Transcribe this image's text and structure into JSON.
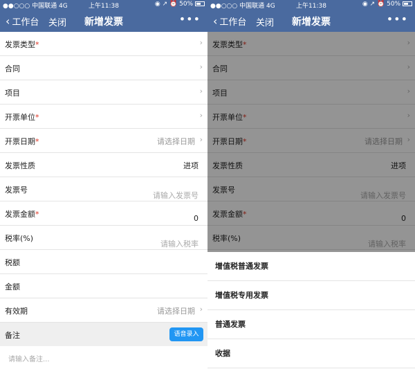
{
  "status": {
    "carrier": "●●○○○ 中国联通  4G",
    "time": "上午11:38",
    "icons": "◉ ↗ ⏰",
    "battery": "50%"
  },
  "nav": {
    "back": "工作台",
    "close": "关闭",
    "title": "新增发票",
    "more": "•••"
  },
  "form": {
    "rows": [
      {
        "label": "发票类型",
        "required": "*",
        "arrow": "›"
      },
      {
        "label": "合同",
        "arrow": "›"
      },
      {
        "label": "项目",
        "arrow": "›"
      },
      {
        "label": "开票单位",
        "required": "*",
        "arrow": "›"
      },
      {
        "label": "开票日期",
        "required": "*",
        "value": "请选择日期",
        "arrow": "›"
      },
      {
        "label": "发票性质",
        "value": "进项"
      },
      {
        "label": "发票号",
        "placeholder": "请输入发票号"
      },
      {
        "label": "发票金额",
        "required": "*",
        "number": "0"
      },
      {
        "label": "税率(%)",
        "placeholder": "请输入税率"
      },
      {
        "label": "税额"
      },
      {
        "label": "金额"
      },
      {
        "label": "有效期",
        "value": "请选择日期",
        "arrow": "›"
      }
    ],
    "remark_label": "备注",
    "voice_button": "语音录入",
    "remark_placeholder": "请输入备注..."
  },
  "sheet": {
    "options": [
      "增值税普通发票",
      "增值税专用发票",
      "普通发票",
      "收据"
    ]
  },
  "colors": {
    "header": "#4a6a9f",
    "voice_button": "#2196f3",
    "required": "#dd3322"
  }
}
